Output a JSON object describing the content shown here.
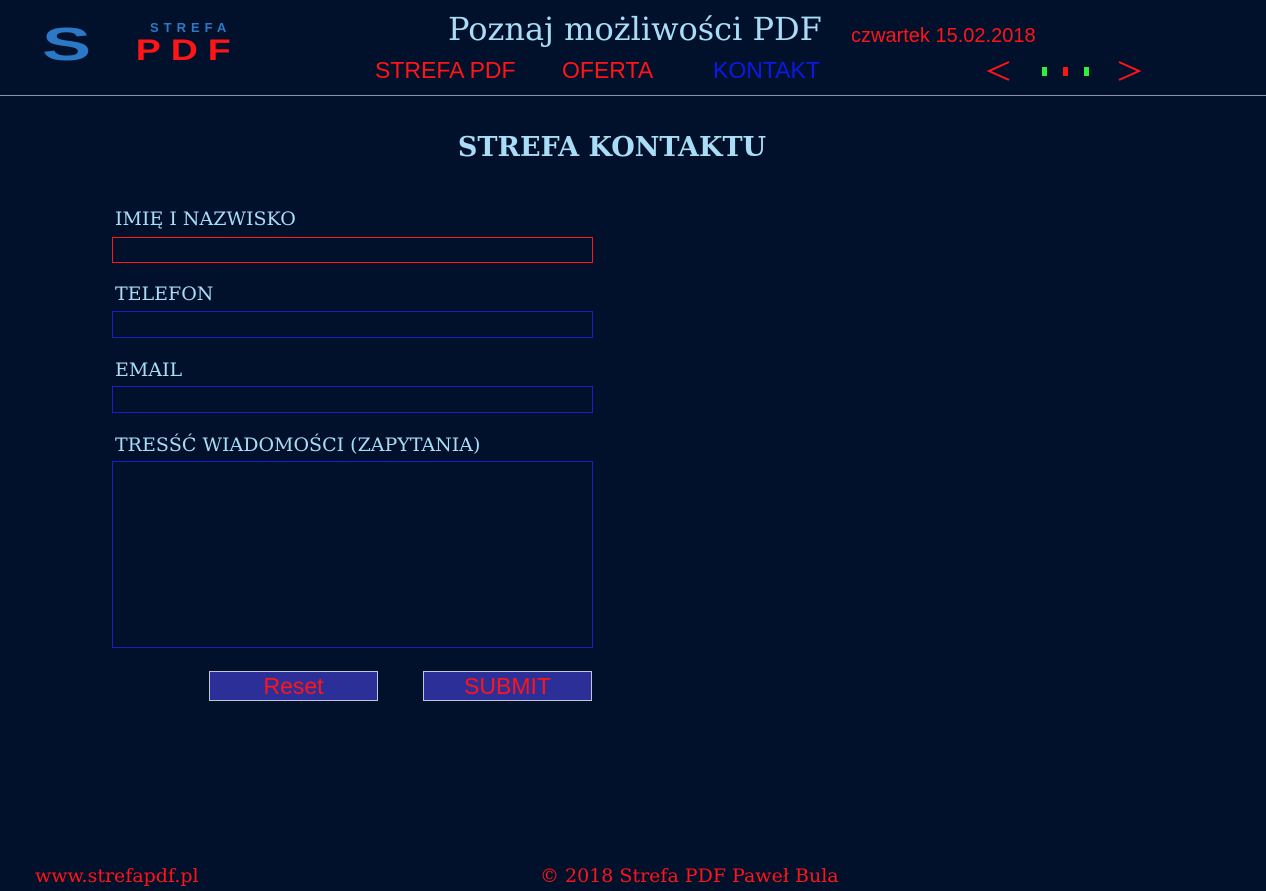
{
  "header": {
    "logo": {
      "text_top": "STREFA",
      "text_main_1": "S",
      "text_main_2": "PDF",
      "primary_color": "#2a78c6",
      "accent_color": "#ff1418"
    },
    "title": "Poznaj możliwości PDF",
    "date": "czwartek 15.02.2018",
    "nav": [
      {
        "label": "STREFA PDF",
        "color": "#ff1418"
      },
      {
        "label": "OFERTA",
        "color": "#ff1418"
      },
      {
        "label": "KONTAKT",
        "color": "#0a1ae6",
        "active": true
      }
    ],
    "slider": {
      "prev_icon": "chevron-left-icon",
      "next_icon": "chevron-right-icon",
      "dots": [
        "#2cf23a",
        "#ff1418",
        "#2cf23a"
      ]
    }
  },
  "contact": {
    "title": "STREFA KONTAKTU",
    "fields": {
      "name_label": "IMIĘ I NAZWISKO",
      "phone_label": "TELEFON",
      "email_label": "EMAIL",
      "message_label": "TRESŚĆ WIADOMOŚCI (ZAPYTANIA)",
      "name_value": "",
      "phone_value": "",
      "email_value": "",
      "message_value": ""
    },
    "buttons": {
      "reset": "Reset",
      "submit": "SUBMIT"
    }
  },
  "footer": {
    "url": "www.strefapdf.pl",
    "copyright": "© 2018 Strefa PDF Paweł Bula"
  },
  "colors": {
    "background": "#02112b",
    "label_text": "#a9dcf6",
    "accent_red": "#ff1418",
    "field_border": "#1a1fc9",
    "button_bg": "#2d2f98"
  }
}
